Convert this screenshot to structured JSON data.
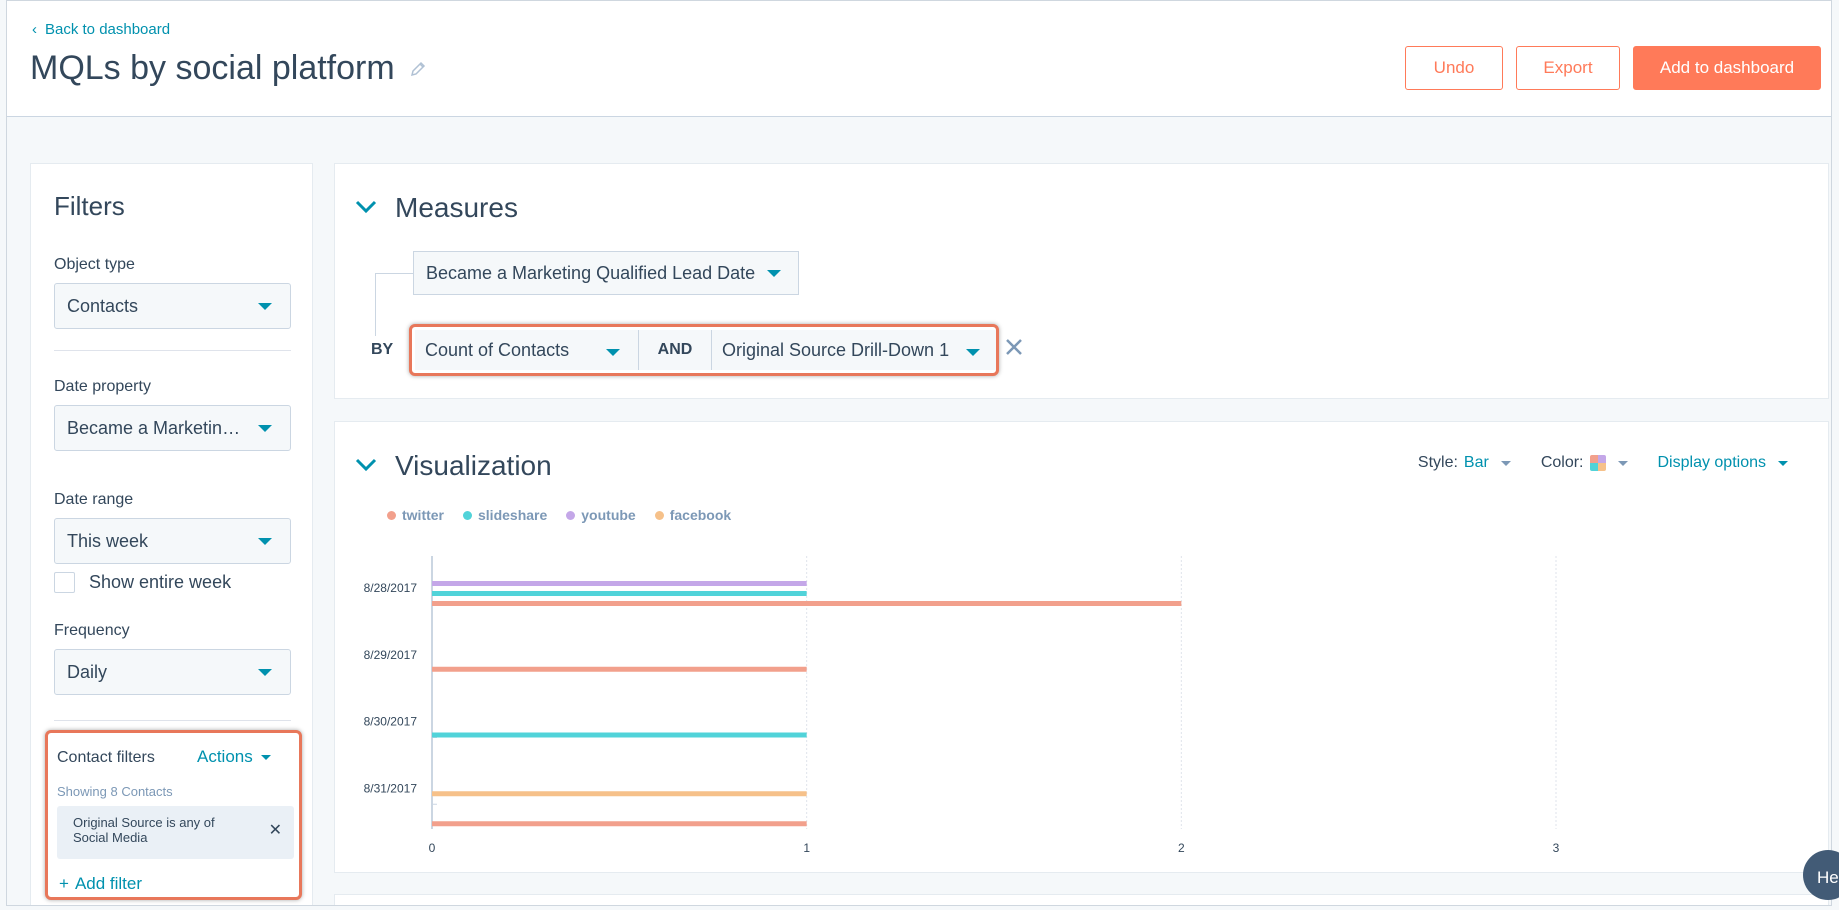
{
  "header": {
    "back_label": "Back to dashboard",
    "title": "MQLs by social platform",
    "undo_label": "Undo",
    "export_label": "Export",
    "add_label": "Add to dashboard"
  },
  "filters": {
    "title": "Filters",
    "object_type_label": "Object type",
    "object_type_value": "Contacts",
    "date_property_label": "Date property",
    "date_property_value": "Became a Marketing Qualified Lead Date",
    "date_range_label": "Date range",
    "date_range_value": "This week",
    "show_entire_week_label": "Show entire week",
    "frequency_label": "Frequency",
    "frequency_value": "Daily",
    "contact_filters": {
      "title": "Contact filters",
      "actions_label": "Actions",
      "showing_text": "Showing 8 Contacts",
      "chip_line1": "Original Source is any of",
      "chip_line2": "Social Media",
      "add_filter_label": "Add filter"
    }
  },
  "measures": {
    "title": "Measures",
    "date_measure": "Became a Marketing Qualified Lead Date",
    "by_label": "BY",
    "count_measure": "Count of Contacts",
    "and_label": "AND",
    "source_measure": "Original Source Drill-Down 1"
  },
  "visualization": {
    "title": "Visualization",
    "style_label": "Style:",
    "style_value": "Bar",
    "color_label": "Color:",
    "display_options_label": "Display options"
  },
  "colors": {
    "accent": "#0091ae",
    "brand": "#ff7a59",
    "highlight": "#e8775a"
  },
  "chart_data": {
    "type": "bar",
    "orientation": "horizontal",
    "categories": [
      "8/28/2017",
      "8/29/2017",
      "8/30/2017",
      "8/31/2017"
    ],
    "series": [
      {
        "name": "twitter",
        "color": "#f2a08c",
        "values": [
          2,
          1,
          0,
          1
        ]
      },
      {
        "name": "slideshare",
        "color": "#51d3d9",
        "values": [
          1,
          0,
          1,
          0
        ]
      },
      {
        "name": "youtube",
        "color": "#c4a7e8",
        "values": [
          1,
          0,
          0,
          0
        ]
      },
      {
        "name": "facebook",
        "color": "#f6c18a",
        "values": [
          0,
          0,
          0,
          1
        ]
      }
    ],
    "x_ticks": [
      "0",
      "1",
      "2",
      "3"
    ],
    "xlim": [
      0,
      3
    ],
    "grid": true,
    "legend_position": "top-left"
  },
  "help": {
    "label": "He"
  }
}
